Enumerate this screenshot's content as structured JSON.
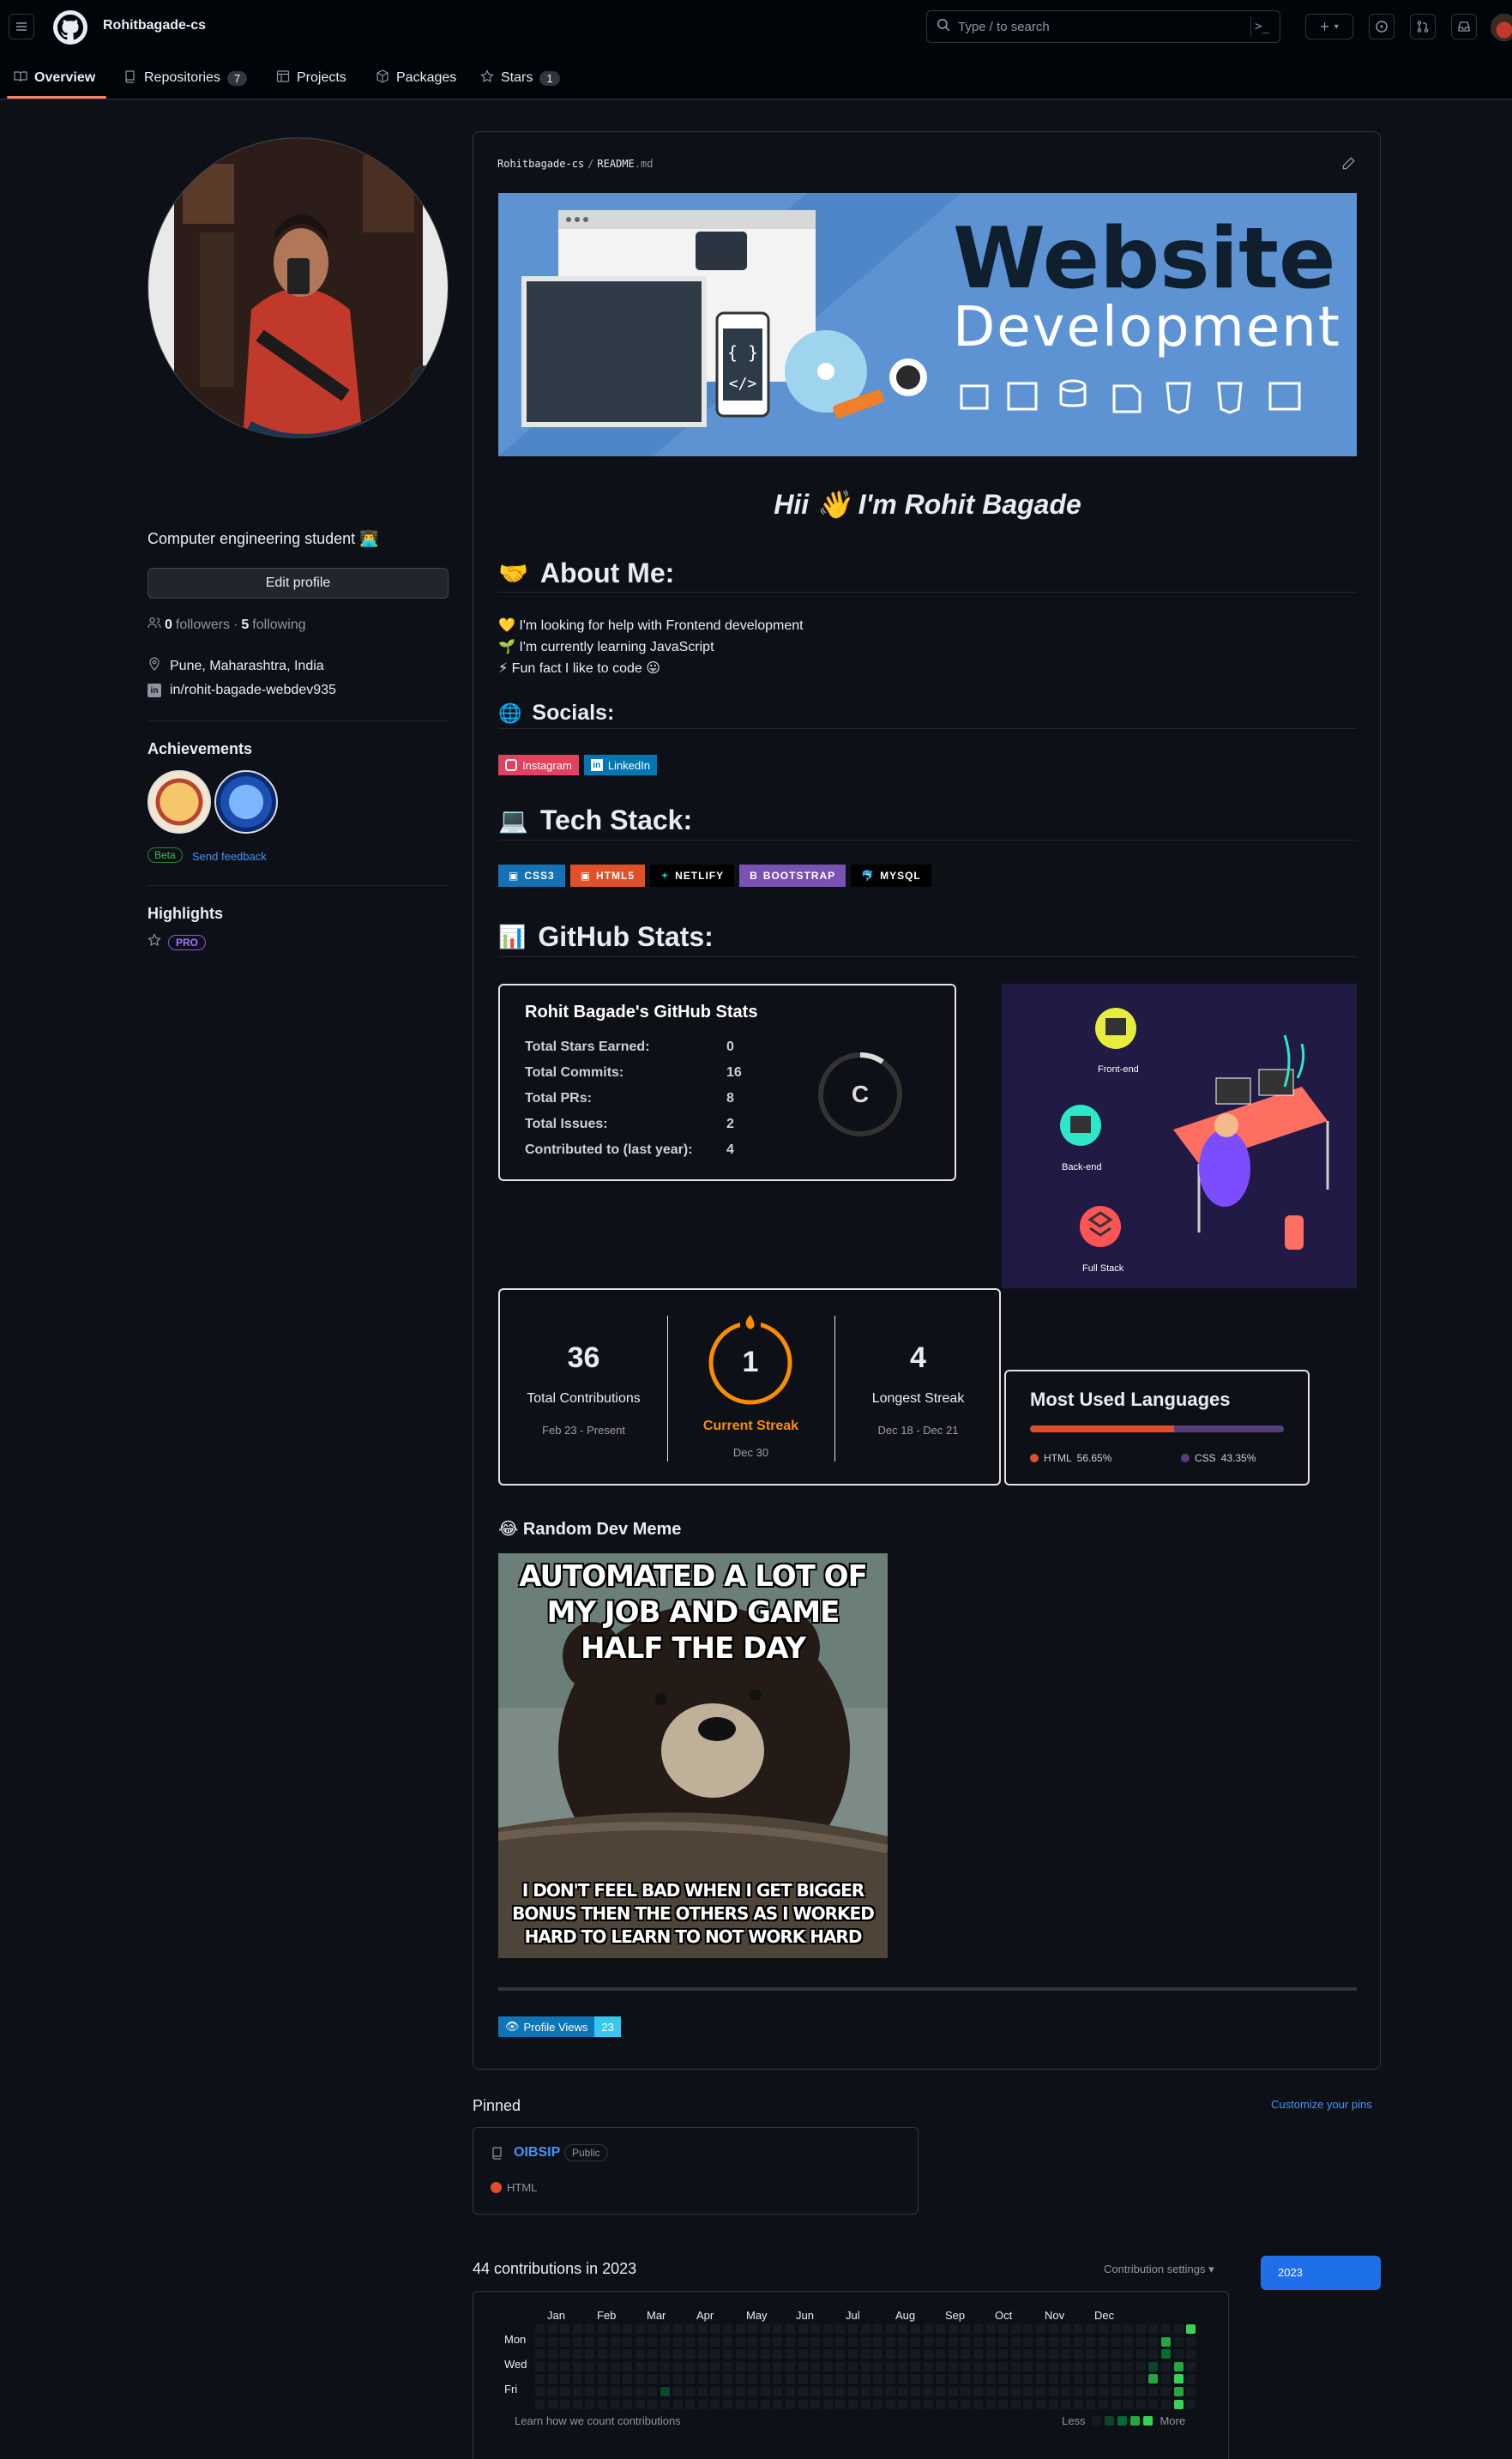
{
  "header": {
    "username": "Rohitbagade-cs",
    "search_placeholder": "Type / to search"
  },
  "nav": {
    "tabs": [
      {
        "label": "Overview"
      },
      {
        "label": "Repositories",
        "count": "7"
      },
      {
        "label": "Projects"
      },
      {
        "label": "Packages"
      },
      {
        "label": "Stars",
        "count": "1"
      }
    ]
  },
  "profile": {
    "bio": "Computer engineering student 👨‍💻",
    "edit_label": "Edit profile",
    "followers_count": "0",
    "followers_label": "followers",
    "following_count": "5",
    "following_label": "following",
    "location": "Pune, Maharashtra, India",
    "linkedin": "in/rohit-bagade-webdev935",
    "achievements_title": "Achievements",
    "beta_label": "Beta",
    "feedback_label": "Send feedback",
    "highlights_title": "Highlights",
    "pro_label": "PRO"
  },
  "readme": {
    "path_user": "Rohitbagade-cs",
    "path_sep": "/",
    "path_file": "README",
    "path_ext": ".md",
    "banner_title_1": "Website",
    "banner_title_2": "Development",
    "greeting": "Hii 👋 I'm Rohit Bagade",
    "about_title": "About Me:",
    "about_items": [
      "💛 I'm looking for help with Frontend development",
      "🌱 I'm currently learning JavaScript",
      "⚡ Fun fact I like to code 😛"
    ],
    "socials_title": "Socials:",
    "socials": [
      {
        "label": "Instagram",
        "color": "#e4405f"
      },
      {
        "label": "LinkedIn",
        "color": "#0077b5"
      }
    ],
    "tech_title": "Tech Stack:",
    "tech": [
      {
        "label": "CSS3",
        "color": "#1572b6"
      },
      {
        "label": "HTML5",
        "color": "#e34f26"
      },
      {
        "label": "NETLIFY",
        "color": "#000000"
      },
      {
        "label": "BOOTSTRAP",
        "color": "#7952b3"
      },
      {
        "label": "MYSQL",
        "color": "#000000"
      }
    ],
    "stats_title": "GitHub Stats:",
    "stats_card": {
      "title": "Rohit Bagade's GitHub Stats",
      "rows": [
        {
          "label": "Total Stars Earned:",
          "value": "0"
        },
        {
          "label": "Total Commits:",
          "value": "16"
        },
        {
          "label": "Total PRs:",
          "value": "8"
        },
        {
          "label": "Total Issues:",
          "value": "2"
        },
        {
          "label": "Contributed to (last year):",
          "value": "4"
        }
      ],
      "rank": "C"
    },
    "illustration_labels": [
      "Front-end",
      "Back-end",
      "Full Stack"
    ],
    "streak": {
      "total": "36",
      "total_label": "Total Contributions",
      "total_range": "Feb 23 - Present",
      "current": "1",
      "current_label": "Current Streak",
      "current_date": "Dec 30",
      "longest": "4",
      "longest_label": "Longest Streak",
      "longest_range": "Dec 18 - Dec 21"
    },
    "languages": {
      "title": "Most Used Languages",
      "items": [
        {
          "name": "HTML",
          "percent": "56.65%",
          "share": 0.5665,
          "color": "#e34c26"
        },
        {
          "name": "CSS",
          "percent": "43.35%",
          "share": 0.4335,
          "color": "#563d7c"
        }
      ]
    },
    "meme_title": "😂 Random Dev Meme",
    "meme_top": "AUTOMATED A LOT OF MY JOB AND GAME HALF THE DAY",
    "meme_bottom": "I DON'T FEEL BAD WHEN I GET BIGGER BONUS THEN THE OTHERS AS I WORKED HARD TO LEARN TO NOT WORK HARD",
    "views_label": "Profile Views",
    "views_count": "23"
  },
  "pinned": {
    "title": "Pinned",
    "customize": "Customize your pins",
    "repo_name": "OIBSIP",
    "repo_visibility": "Public",
    "repo_lang": "HTML",
    "repo_lang_color": "#e34c26"
  },
  "contributions": {
    "title": "44 contributions in 2023",
    "settings": "Contribution settings ▾",
    "year": "2023",
    "months": [
      "Jan",
      "Feb",
      "Mar",
      "Apr",
      "May",
      "Jun",
      "Jul",
      "Aug",
      "Sep",
      "Oct",
      "Nov",
      "Dec"
    ],
    "days": [
      "Mon",
      "Wed",
      "Fri"
    ],
    "learn": "Learn how we count contributions",
    "less": "Less",
    "more": "More"
  }
}
